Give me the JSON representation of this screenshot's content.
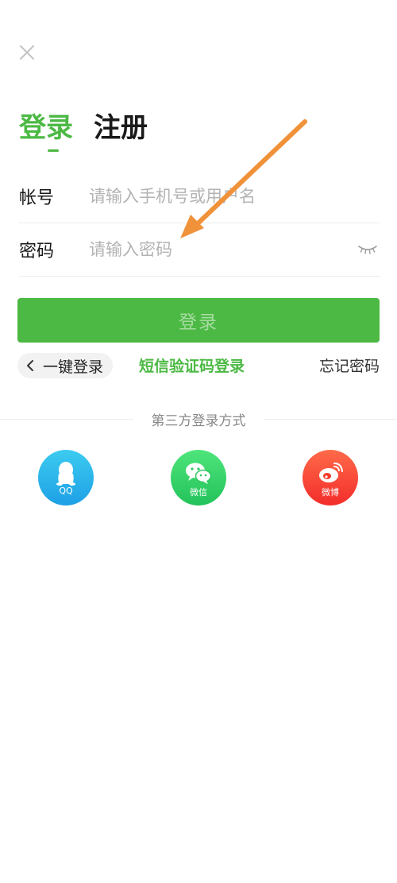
{
  "icons": {
    "close": "close-icon",
    "eye": "eye-closed-icon",
    "chevron": "chevron-left-icon",
    "qq": "qq-icon",
    "wechat": "wechat-icon",
    "weibo": "weibo-icon",
    "annotation": "arrow-annotation"
  },
  "colors": {
    "accent": "#4cb944",
    "login_button_text": "#a6dca1",
    "qq": "#1ea0e6",
    "wechat": "#23c25a",
    "weibo": "#f32d2a",
    "annotation_arrow": "#f0923a"
  },
  "tabs": {
    "login": "登录",
    "register": "注册"
  },
  "form": {
    "account_label": "帐号",
    "account_placeholder": "请输入手机号或用户名",
    "account_value": "",
    "password_label": "密码",
    "password_placeholder": "请输入密码",
    "password_value": ""
  },
  "actions": {
    "login_button": "登录",
    "one_key_login": "一键登录",
    "sms_login": "短信验证码登录",
    "forgot_password": "忘记密码"
  },
  "third_party": {
    "title": "第三方登录方式",
    "providers": [
      {
        "label": "QQ"
      },
      {
        "label": "微信"
      },
      {
        "label": "微博"
      }
    ]
  }
}
